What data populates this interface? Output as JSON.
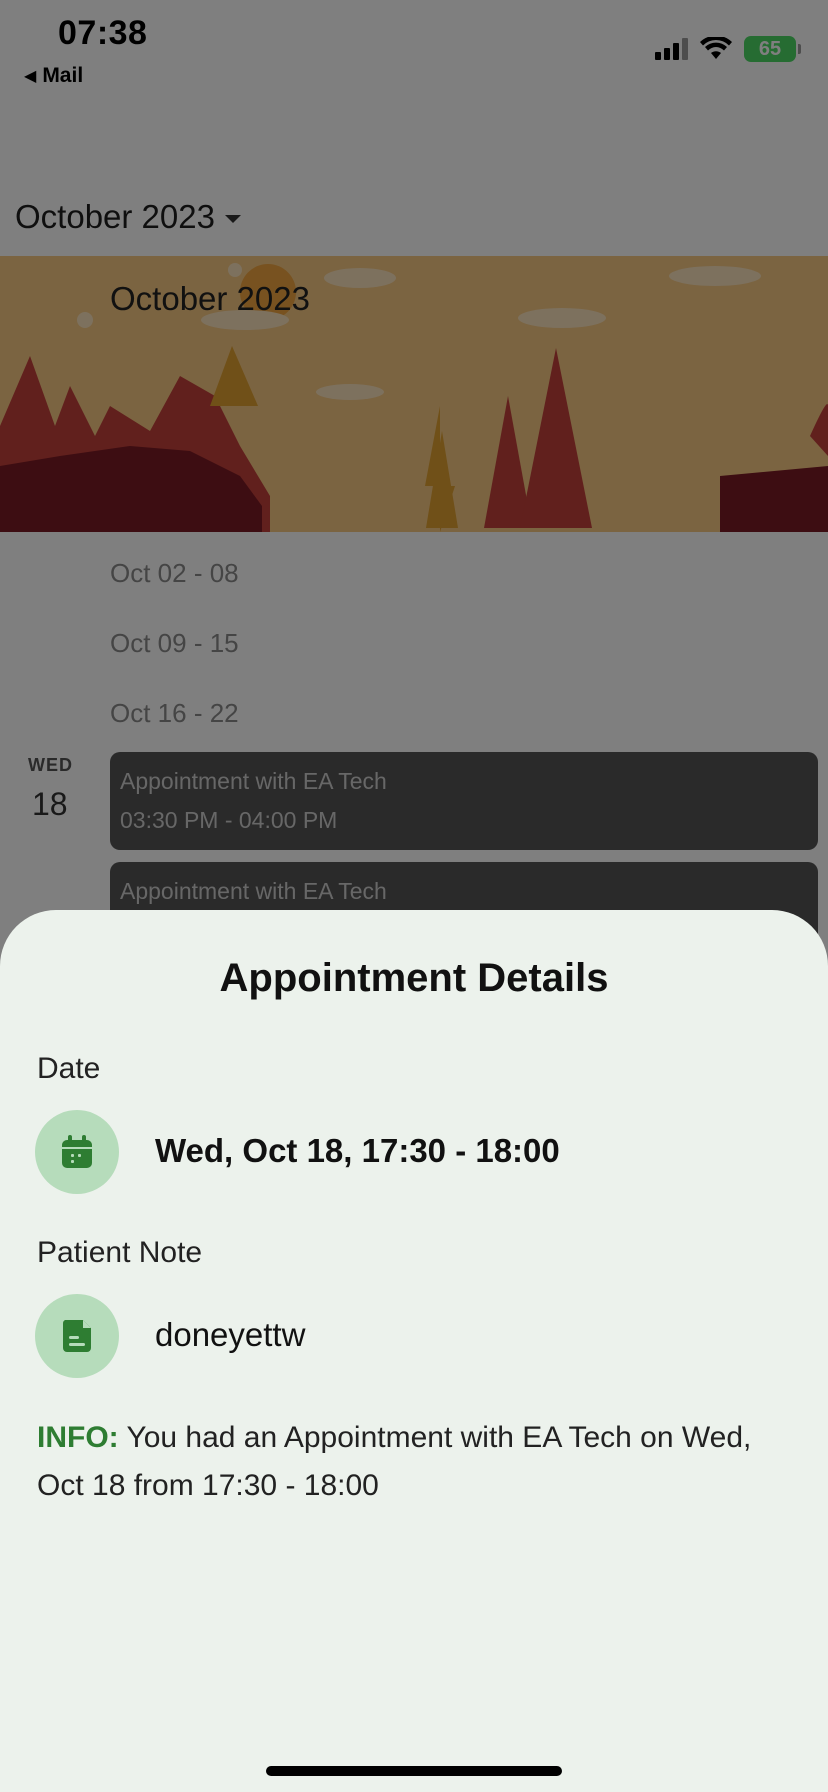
{
  "status_bar": {
    "time": "07:38",
    "back_label": "Mail",
    "battery": "65"
  },
  "calendar": {
    "month_selector": "October 2023",
    "banner_title": "October 2023",
    "weeks": [
      "Oct 02 - 08",
      "Oct 09 - 15",
      "Oct 16 - 22"
    ],
    "day": {
      "weekday": "WED",
      "date": "18"
    },
    "appointments": [
      {
        "title": "Appointment with EA Tech",
        "time": "03:30 PM - 04:00 PM"
      },
      {
        "title": "Appointment with EA Tech",
        "time": ""
      }
    ]
  },
  "sheet": {
    "title": "Appointment Details",
    "date_label": "Date",
    "date_value": "Wed, Oct 18, 17:30 - 18:00",
    "note_label": "Patient Note",
    "note_value": "doneyettw",
    "info_label": "INFO:",
    "info_text": " You had an  Appointment with EA Tech on Wed, Oct 18 from 17:30 - 18:00",
    "date_icon": "calendar-icon",
    "note_icon": "note-icon"
  },
  "colors": {
    "sheet_bg": "#ecf2ec",
    "icon_circle": "#b6dcbb",
    "icon_fill": "#2e7d32",
    "info_accent": "#2e7d32",
    "banner_bg": "#f7c882"
  }
}
